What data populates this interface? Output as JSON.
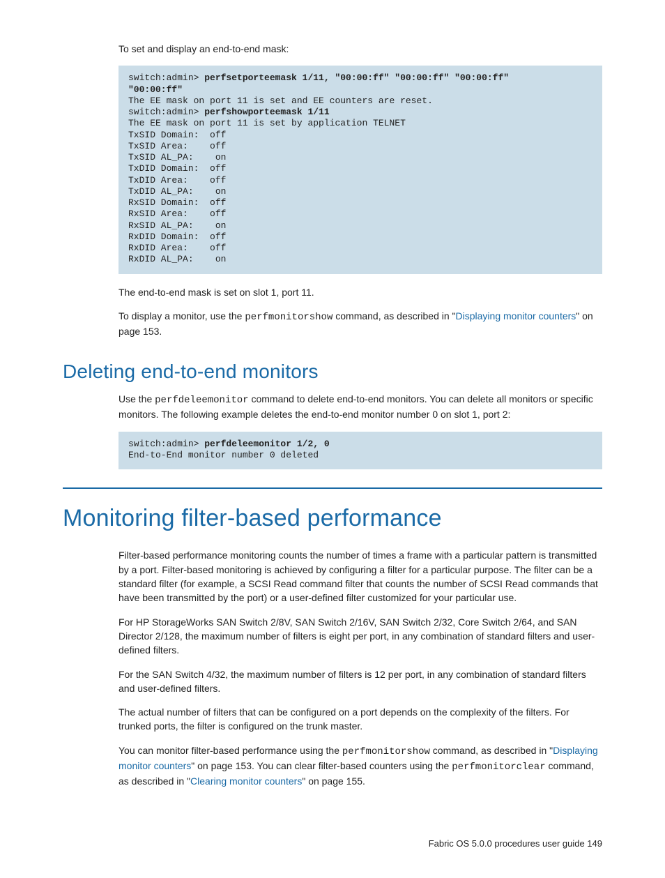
{
  "intro1": "To set and display an end-to-end mask:",
  "code1": {
    "l1a": "switch:admin> ",
    "l1b": "perfsetporteemask 1/11, \"00:00:ff\" \"00:00:ff\" \"00:00:ff\"",
    "l2b": "\"00:00:ff\"",
    "l3": "The EE mask on port 11 is set and EE counters are reset.",
    "l4a": "switch:admin> ",
    "l4b": "perfshowporteemask 1/11",
    "l5": "The EE mask on port 11 is set by application TELNET",
    "l6": "TxSID Domain:  off",
    "l7": "TxSID Area:    off",
    "l8": "TxSID AL_PA:    on",
    "l9": "TxDID Domain:  off",
    "l10": "TxDID Area:    off",
    "l11": "TxDID AL_PA:    on",
    "l12": "RxSID Domain:  off",
    "l13": "RxSID Area:    off",
    "l14": "RxSID AL_PA:    on",
    "l15": "RxDID Domain:  off",
    "l16": "RxDID Area:    off",
    "l17": "RxDID AL_PA:    on"
  },
  "p2": "The end-to-end mask is set on slot 1, port 11.",
  "p3a": "To display a monitor, use the ",
  "p3mono": "perfmonitorshow",
  "p3b": " command, as described in \"",
  "p3link": "Displaying monitor counters",
  "p3c": "\" on page 153.",
  "h_del": "Deleting end-to-end monitors",
  "p4a": "Use the ",
  "p4mono": "perfdeleemonitor",
  "p4b": " command to delete end-to-end monitors. You can delete all monitors or specific monitors. The following example deletes the end-to-end monitor number 0 on slot 1, port 2:",
  "code2": {
    "l1a": "switch:admin> ",
    "l1b": "perfdeleemonitor 1/2, 0",
    "l2": "End-to-End monitor number 0 deleted"
  },
  "h_mon": "Monitoring filter-based performance",
  "p5": "Filter-based performance monitoring counts the number of times a frame with a particular pattern is transmitted by a port. Filter-based monitoring is achieved by configuring a filter for a particular purpose. The filter can be a standard filter (for example, a SCSI Read command filter that counts the number of SCSI Read commands that have been transmitted by the port) or a user-defined filter customized for your particular use.",
  "p6": "For HP StorageWorks SAN Switch 2/8V, SAN Switch 2/16V, SAN Switch 2/32, Core Switch 2/64, and SAN Director 2/128, the maximum number of filters is eight per port, in any combination of standard filters and user-defined filters.",
  "p7": "For the SAN Switch 4/32, the maximum number of filters is 12 per port, in any combination of standard filters and user-defined filters.",
  "p8": "The actual number of filters that can be configured on a port depends on the complexity of the filters. For trunked ports, the filter is configured on the trunk master.",
  "p9a": "You can monitor filter-based performance using the ",
  "p9mono1": "perfmonitorshow",
  "p9b": " command, as described in \"",
  "p9link1": "Displaying monitor counters",
  "p9c": "\" on page 153. You can clear filter-based counters using the ",
  "p9mono2": "perfmonitorclear",
  "p9d": " command, as described in \"",
  "p9link2": "Clearing monitor counters",
  "p9e": "\" on page 155.",
  "footer": "Fabric OS 5.0.0 procedures user guide   149"
}
